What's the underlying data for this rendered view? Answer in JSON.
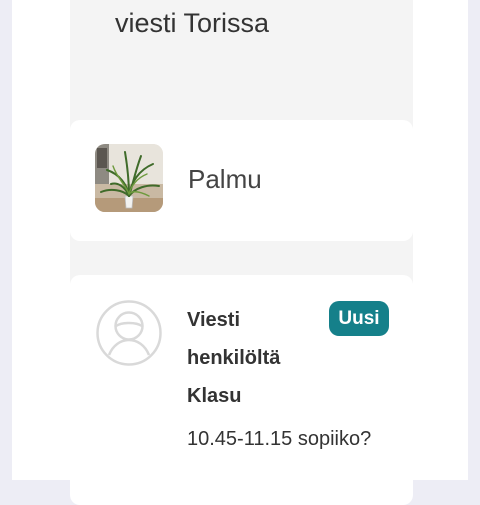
{
  "header": {
    "title": "viesti Torissa"
  },
  "listing": {
    "title": "Palmu",
    "image_icon": "plant-photo"
  },
  "message": {
    "sender": "Viesti henkilöltä Klasu",
    "badge": "Uusi",
    "body": "10.45-11.15 sopiiko?",
    "avatar_icon": "default-avatar-icon"
  },
  "colors": {
    "badge_background": "#15808a",
    "page_background": "#f4f4f4",
    "card_background": "#ffffff"
  }
}
